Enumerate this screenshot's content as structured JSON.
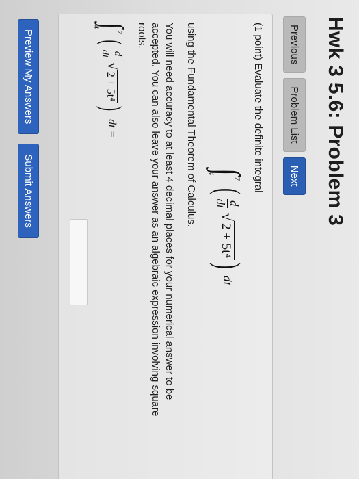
{
  "header": {
    "title": "Hwk 3 5.6: Problem 3"
  },
  "nav": {
    "previous": "Previous",
    "problem_list": "Problem List",
    "next": "Next"
  },
  "problem": {
    "intro": "(1 point) Evaluate the definite integral",
    "integral": {
      "lower": "4",
      "upper": "7",
      "derivative_num": "d",
      "derivative_den": "dt",
      "radicand": "2 + 5t⁴",
      "differential": "dt"
    },
    "after_integral": "using the Fundamental Theorem of Calculus.",
    "instructions_1": "You will need accuracy to at least 4 decimal places for your numerical answer to be",
    "instructions_2": "accepted. You can also leave your answer as an algebraic expression involving square",
    "instructions_3": "roots.",
    "answer_eq": "dt =",
    "answer_value": ""
  },
  "actions": {
    "preview": "Preview My Answers",
    "submit": "Submit Answers"
  },
  "colors": {
    "primary_button": "#2d63bd",
    "secondary_button": "#b9b9b9"
  }
}
